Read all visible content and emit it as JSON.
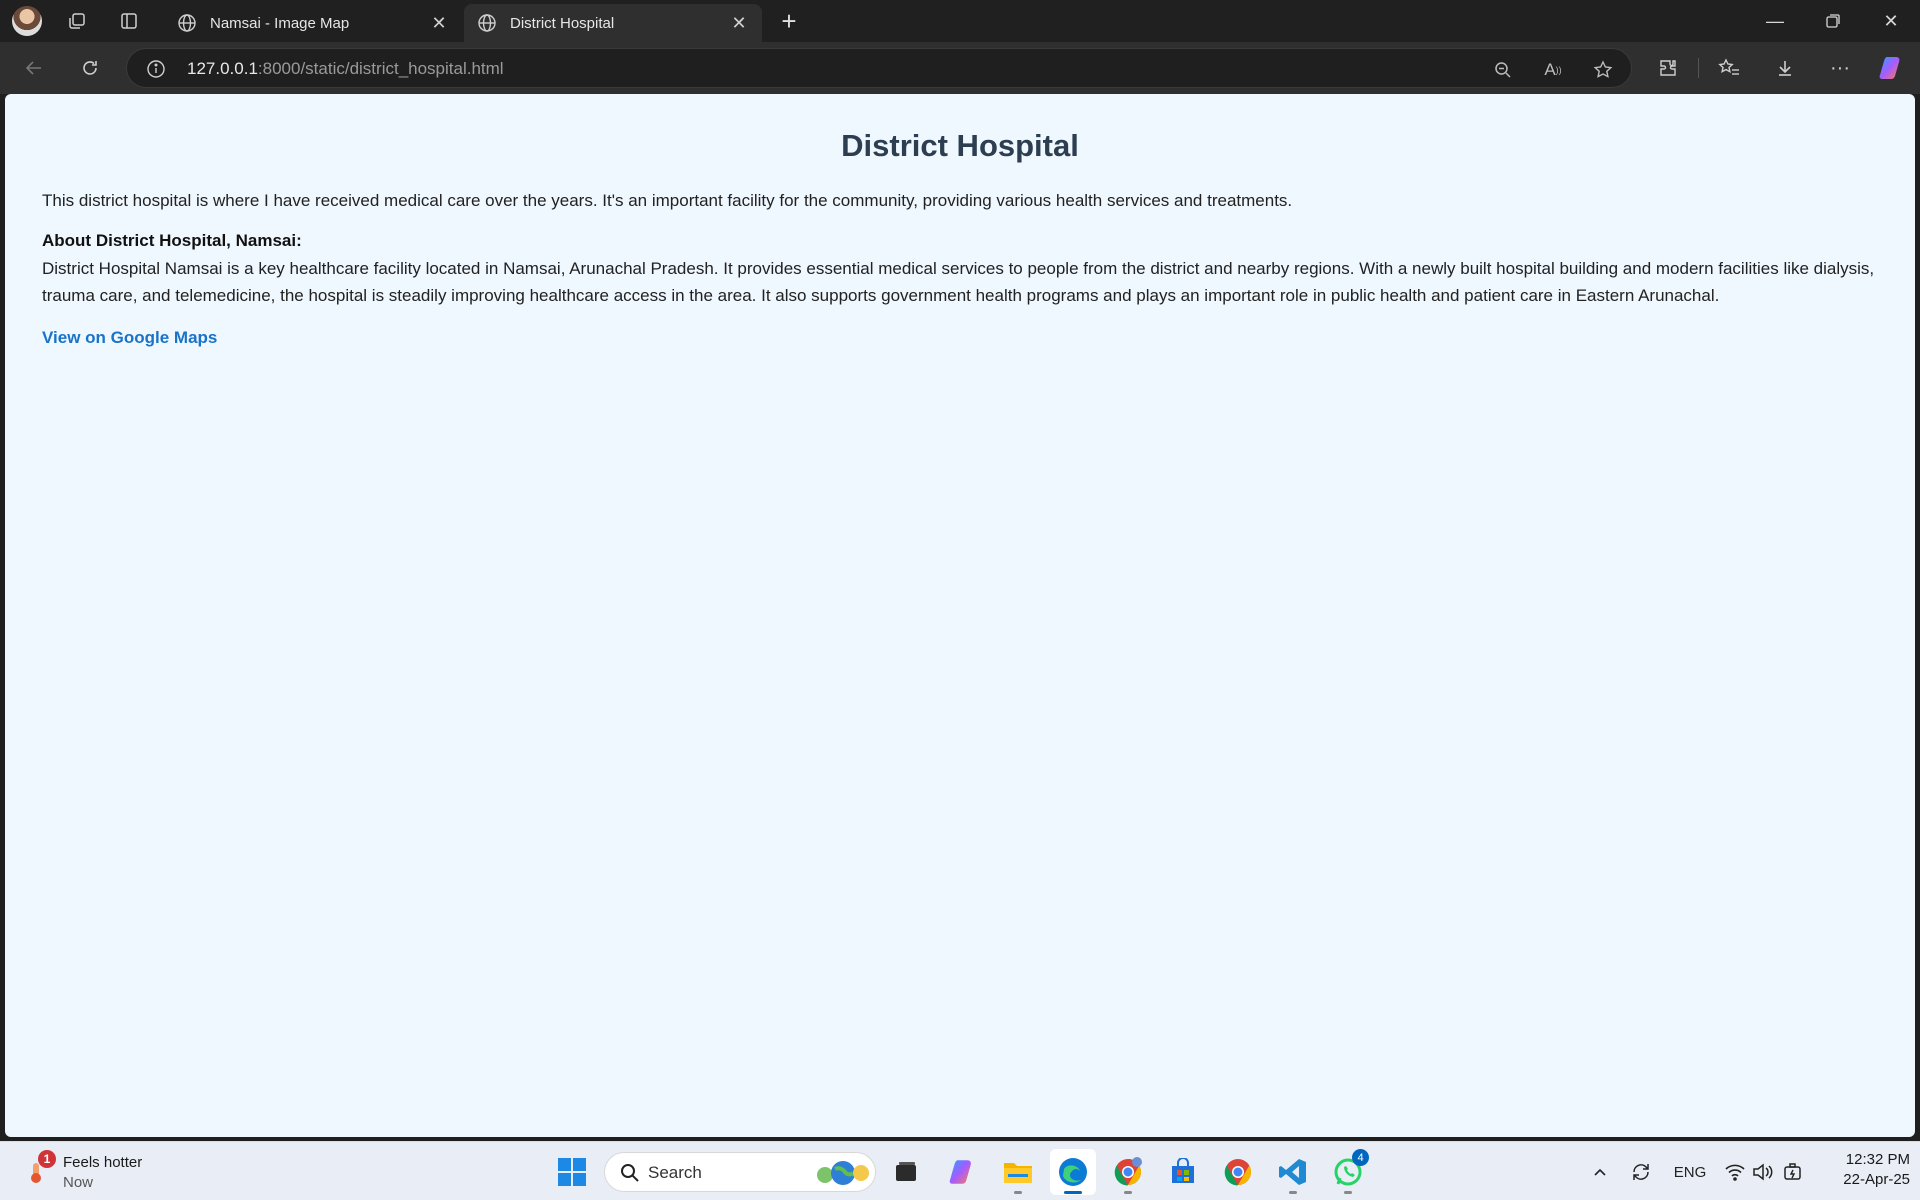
{
  "browser": {
    "tabs": [
      {
        "label": "Namsai - Image Map",
        "active": false
      },
      {
        "label": "District Hospital",
        "active": true
      }
    ],
    "url": {
      "host": "127.0.0.1",
      "rest": ":8000/static/district_hospital.html"
    },
    "icons": {
      "profile": "avatar",
      "workspaces": "workspaces-icon",
      "vertical_tabs": "tab-actions-icon",
      "tab_favicon": "globe-icon",
      "close_tab": "close-icon",
      "new_tab": "plus-icon",
      "back": "back-arrow-icon",
      "refresh": "refresh-icon",
      "site_info": "info-icon",
      "zoom": "zoom-out-icon",
      "read_aloud": "read-aloud-icon",
      "favorite": "star-icon",
      "extensions": "extensions-icon",
      "favorites": "favorites-icon",
      "downloads": "download-icon",
      "more": "more-icon",
      "copilot": "copilot-icon"
    }
  },
  "page": {
    "title": "District Hospital",
    "intro": "This district hospital is where I have received medical care over the years. It's an important facility for the community, providing various health services and treatments.",
    "about_heading": "About District Hospital, Namsai:",
    "about_text": "District Hospital Namsai is a key healthcare facility located in Namsai, Arunachal Pradesh. It provides essential medical services to people from the district and nearby regions. With a newly built hospital building and modern facilities like dialysis, trauma care, and telemedicine, the hospital is steadily improving healthcare access in the area. It also supports government health programs and plays an important role in public health and patient care in Eastern Arunachal.",
    "maps_link": "View on Google Maps",
    "colors": {
      "background": "#eff7ff",
      "title": "#2c3e50",
      "link": "#1a73c8"
    }
  },
  "taskbar": {
    "weather": {
      "badge": "1",
      "line1": "Feels hotter",
      "line2": "Now"
    },
    "search_placeholder": "Search",
    "tray": {
      "language": "ENG"
    },
    "clock": {
      "time": "12:32 PM",
      "date": "22-Apr-25"
    },
    "whatsapp_badge": "4"
  }
}
